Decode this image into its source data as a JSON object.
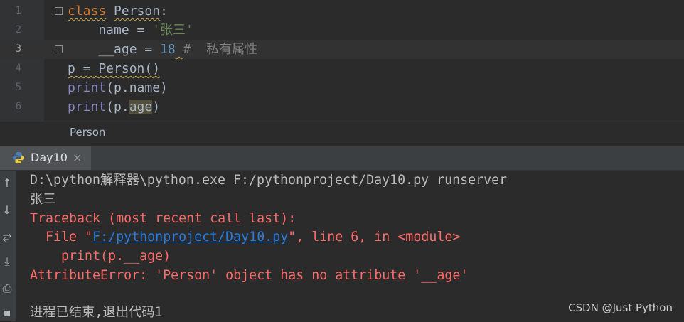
{
  "editor": {
    "lines": [
      {
        "n": "1",
        "parts": [
          {
            "t": "class",
            "c": "kw squig"
          },
          {
            "t": " "
          },
          {
            "t": "Person",
            "c": "squig"
          },
          {
            "t": ":"
          }
        ]
      },
      {
        "n": "2",
        "parts": [
          {
            "t": "    name = "
          },
          {
            "t": "'张三'",
            "c": "str"
          }
        ]
      },
      {
        "n": "3",
        "parts": [
          {
            "t": "    __age = "
          },
          {
            "t": "18",
            "c": "num"
          },
          {
            "t": " ",
            "c": "squig"
          },
          {
            "t": "#  私有属性",
            "c": "cmt"
          }
        ]
      },
      {
        "n": "4",
        "parts": [
          {
            "t": "p = Person()",
            "c": "squig"
          }
        ]
      },
      {
        "n": "5",
        "parts": [
          {
            "t": "print",
            "c": "builtin"
          },
          {
            "t": "(p.name)"
          }
        ]
      },
      {
        "n": "6",
        "parts": [
          {
            "t": "print",
            "c": "builtin"
          },
          {
            "t": "(p."
          },
          {
            "t": "age",
            "c": "hl"
          },
          {
            "t": ")"
          }
        ]
      }
    ],
    "current_line": "3"
  },
  "breadcrumb": {
    "item": "Person"
  },
  "run_tab": {
    "label": "Day10",
    "close": "×"
  },
  "console": {
    "command": "D:\\python解释器\\python.exe F:/pythonproject/Day10.py runserver",
    "output": "张三",
    "traceback_header": "Traceback (most recent call last):",
    "file_prefix": "  File \"",
    "file_link": "F:/pythonproject/Day10.py",
    "file_suffix": "\", line 6, in <module>",
    "code_line": "    print(p.__age)",
    "error": "AttributeError: 'Person' object has no attribute '__age'",
    "exit": "进程已结束,退出代码1"
  },
  "toolbar_icons": [
    "arrow-up-icon",
    "arrow-down-icon",
    "soft-wrap-icon",
    "scroll-to-end-icon",
    "print-icon",
    "trash-icon"
  ],
  "watermark": "CSDN @Just Python"
}
